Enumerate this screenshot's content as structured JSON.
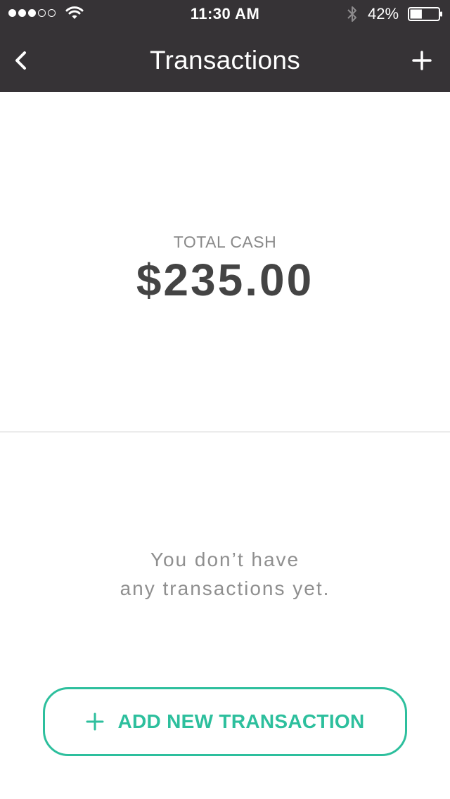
{
  "status_bar": {
    "time": "11:30 AM",
    "battery_percent": "42%",
    "battery_level": 0.42,
    "signal_bars_filled": 3,
    "signal_bars_total": 5
  },
  "nav": {
    "title": "Transactions"
  },
  "summary": {
    "label": "TOTAL CASH",
    "value": "$235.00"
  },
  "empty_state": {
    "line1": "You don’t have",
    "line2": "any transactions yet."
  },
  "actions": {
    "add_transaction_label": "ADD NEW TRANSACTION"
  },
  "colors": {
    "header_bg": "#363336",
    "accent": "#2dbf9d"
  },
  "icons": [
    "back-chevron-icon",
    "plus-icon",
    "wifi-icon",
    "bluetooth-icon",
    "battery-icon"
  ]
}
